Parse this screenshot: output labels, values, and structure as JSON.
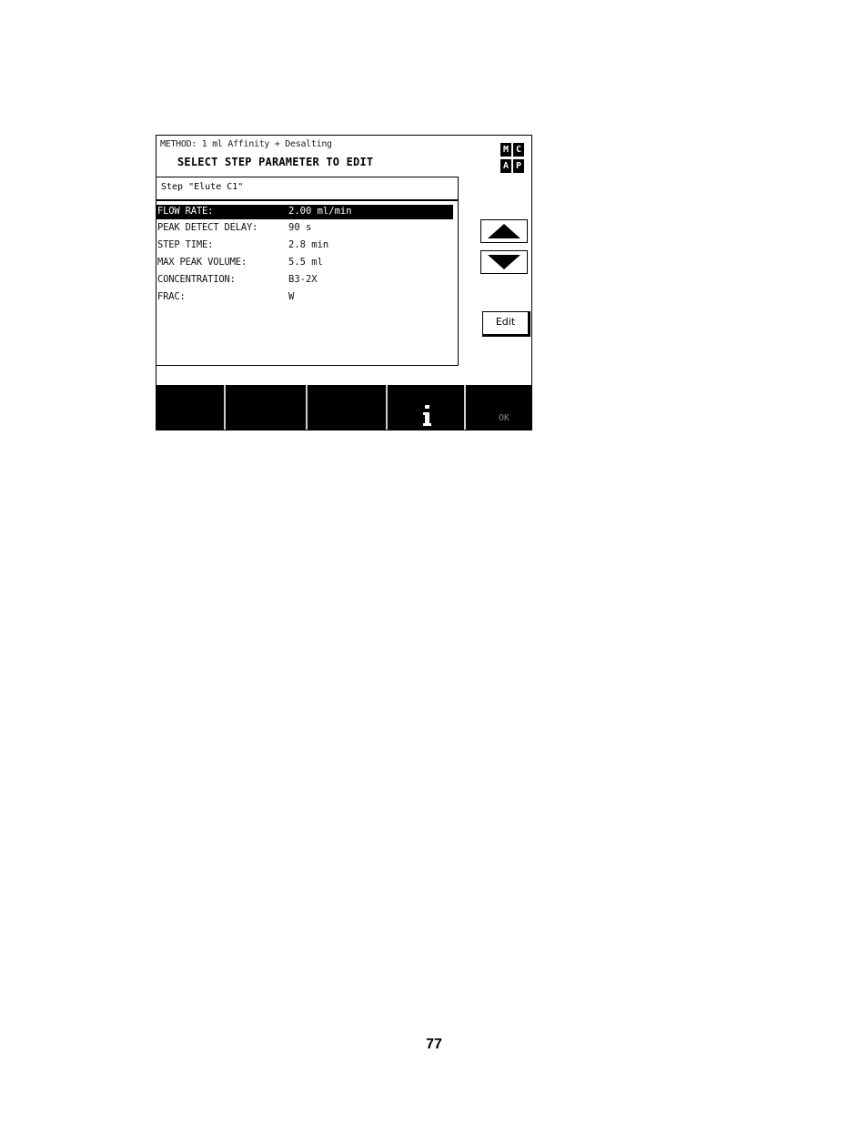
{
  "screen": {
    "method_line": "METHOD: 1 ml Affinity + Desalting",
    "title": "SELECT STEP PARAMETER TO EDIT",
    "logo": [
      "M",
      "C",
      "A",
      "P"
    ],
    "step_label": "Step \"Elute C1\"",
    "parameters": [
      {
        "label": "FLOW RATE:",
        "value": "2.00 ml/min",
        "selected": true
      },
      {
        "label": "PEAK DETECT DELAY:",
        "value": "90 s",
        "selected": false
      },
      {
        "label": "STEP TIME:",
        "value": " 2.8 min",
        "selected": false
      },
      {
        "label": "MAX PEAK VOLUME:",
        "value": " 5.5 ml",
        "selected": false
      },
      {
        "label": "CONCENTRATION:",
        "value": "B3-2X",
        "selected": false
      },
      {
        "label": "FRAC:",
        "value": "W",
        "selected": false
      }
    ],
    "buttons": {
      "up_icon": "triangle-up-icon",
      "down_icon": "triangle-down-icon",
      "edit_label": "Edit"
    },
    "softkeys": {
      "info_icon": "info-icon",
      "ok_label": "OK"
    }
  },
  "page_number": "77"
}
